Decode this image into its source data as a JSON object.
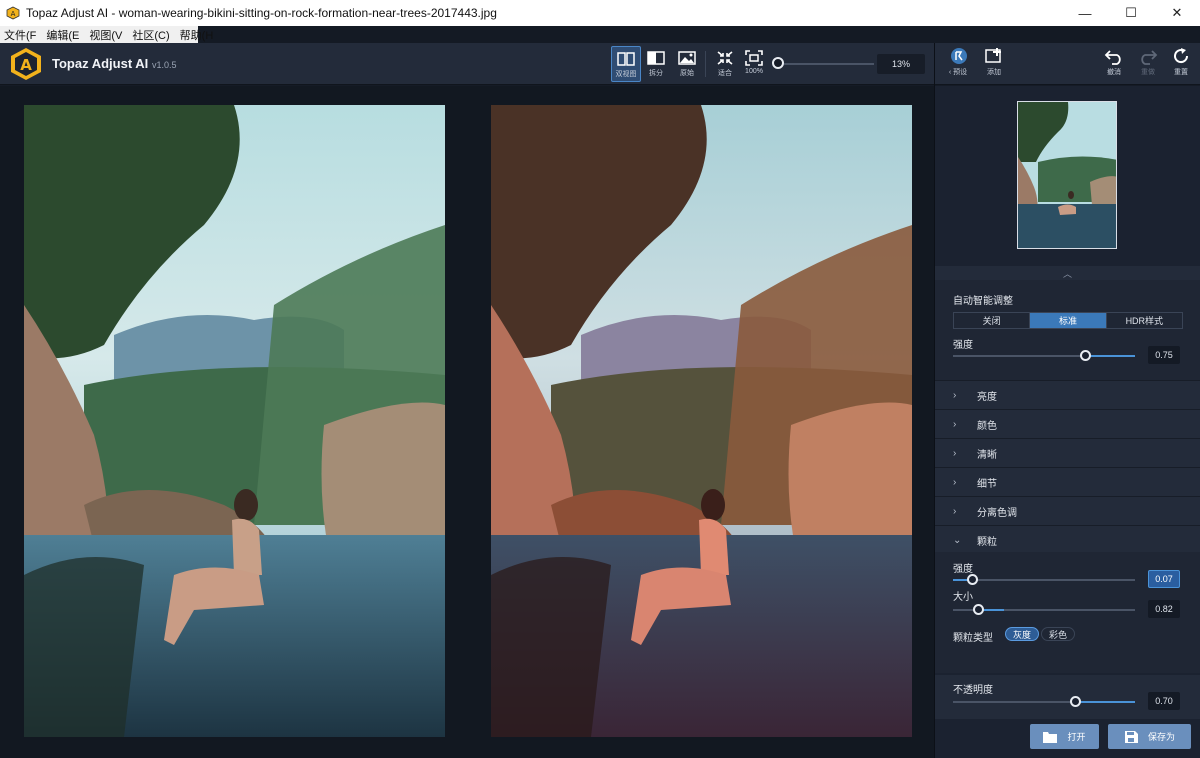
{
  "window": {
    "title": "Topaz Adjust AI - woman-wearing-bikini-sitting-on-rock-formation-near-trees-2017443.jpg",
    "controls": {
      "minimize": "—",
      "maximize": "☐",
      "close": "✕"
    }
  },
  "menu": [
    "文件(F",
    "编辑(E",
    "视图(V",
    "社区(C)",
    "帮助(H"
  ],
  "app": {
    "name": "Topaz Adjust AI",
    "version": "v1.0.5"
  },
  "toolbar": {
    "view_dual": "双视图",
    "view_split": "拆分",
    "view_original": "原始",
    "fit": "适合",
    "zoom_100": "100%",
    "zoom_value": "13%"
  },
  "right_header": {
    "presets": "预设",
    "add": "添加",
    "undo": "撤消",
    "redo": "重做",
    "reset": "重置"
  },
  "panel": {
    "auto_adjust": {
      "title": "自动智能调整",
      "options": [
        "关闭",
        "标准",
        "HDR样式"
      ],
      "selected": "标准",
      "strength_label": "强度",
      "strength_value": "0.75",
      "strength_fraction": 0.75
    },
    "sections": [
      "亮度",
      "颜色",
      "清晰",
      "细节",
      "分离色调"
    ],
    "grain": {
      "title": "颗粒",
      "strength_label": "强度",
      "strength_value": "0.07",
      "strength_fraction": 0.07,
      "size_label": "大小",
      "size_value": "0.82",
      "size_fraction": 0.14,
      "type_label": "颗粒类型",
      "types": [
        "灰度",
        "彩色"
      ],
      "selected_type": "灰度"
    },
    "opacity": {
      "label": "不透明度",
      "value": "0.70",
      "fraction": 0.7
    },
    "footer": {
      "open": "打开",
      "save_as": "保存为"
    }
  },
  "colors": {
    "accent": "#3b79b9",
    "panel_bg": "#1f2634",
    "canvas_bg": "#121821"
  }
}
